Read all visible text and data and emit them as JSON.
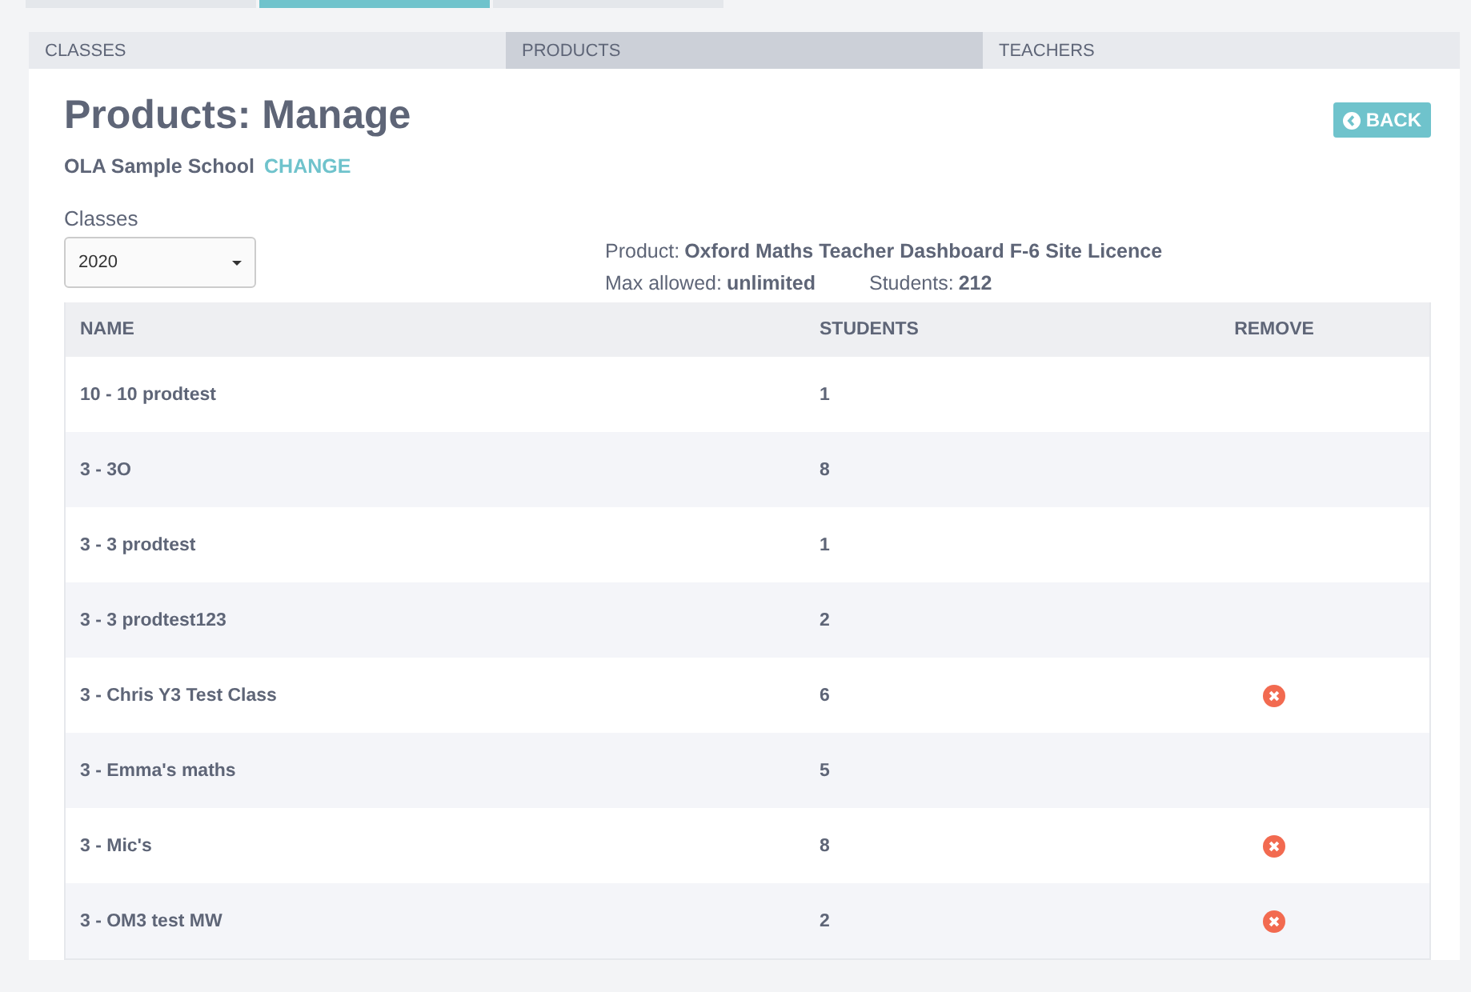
{
  "top_tabs": [
    {
      "selected": false
    },
    {
      "selected": true
    },
    {
      "selected": false
    }
  ],
  "tabs": [
    {
      "label": "CLASSES",
      "selected": false
    },
    {
      "label": "PRODUCTS",
      "selected": true
    },
    {
      "label": "TEACHERS",
      "selected": false
    }
  ],
  "title": "Products: Manage",
  "back_button": "BACK",
  "school": {
    "name": "OLA Sample School",
    "change_link": "CHANGE"
  },
  "classes_select": {
    "label": "Classes",
    "value": "2020"
  },
  "product_info": {
    "product_label": "Product:",
    "product": "Oxford Maths Teacher Dashboard F-6 Site Licence",
    "max_label": "Max allowed:",
    "max": "unlimited",
    "students_label": "Students:",
    "students": "212"
  },
  "table": {
    "columns": [
      "NAME",
      "STUDENTS",
      "REMOVE"
    ],
    "rows": [
      {
        "name": "10 - 10 prodtest",
        "students": "1",
        "removable": false
      },
      {
        "name": "3 - 3O",
        "students": "8",
        "removable": false
      },
      {
        "name": "3 - 3 prodtest",
        "students": "1",
        "removable": false
      },
      {
        "name": "3 - 3 prodtest123",
        "students": "2",
        "removable": false
      },
      {
        "name": "3 - Chris Y3 Test Class",
        "students": "6",
        "removable": true
      },
      {
        "name": "3 - Emma's maths",
        "students": "5",
        "removable": false
      },
      {
        "name": "3 - Mic's",
        "students": "8",
        "removable": true
      },
      {
        "name": "3 - OM3 test MW",
        "students": "2",
        "removable": true
      }
    ]
  }
}
